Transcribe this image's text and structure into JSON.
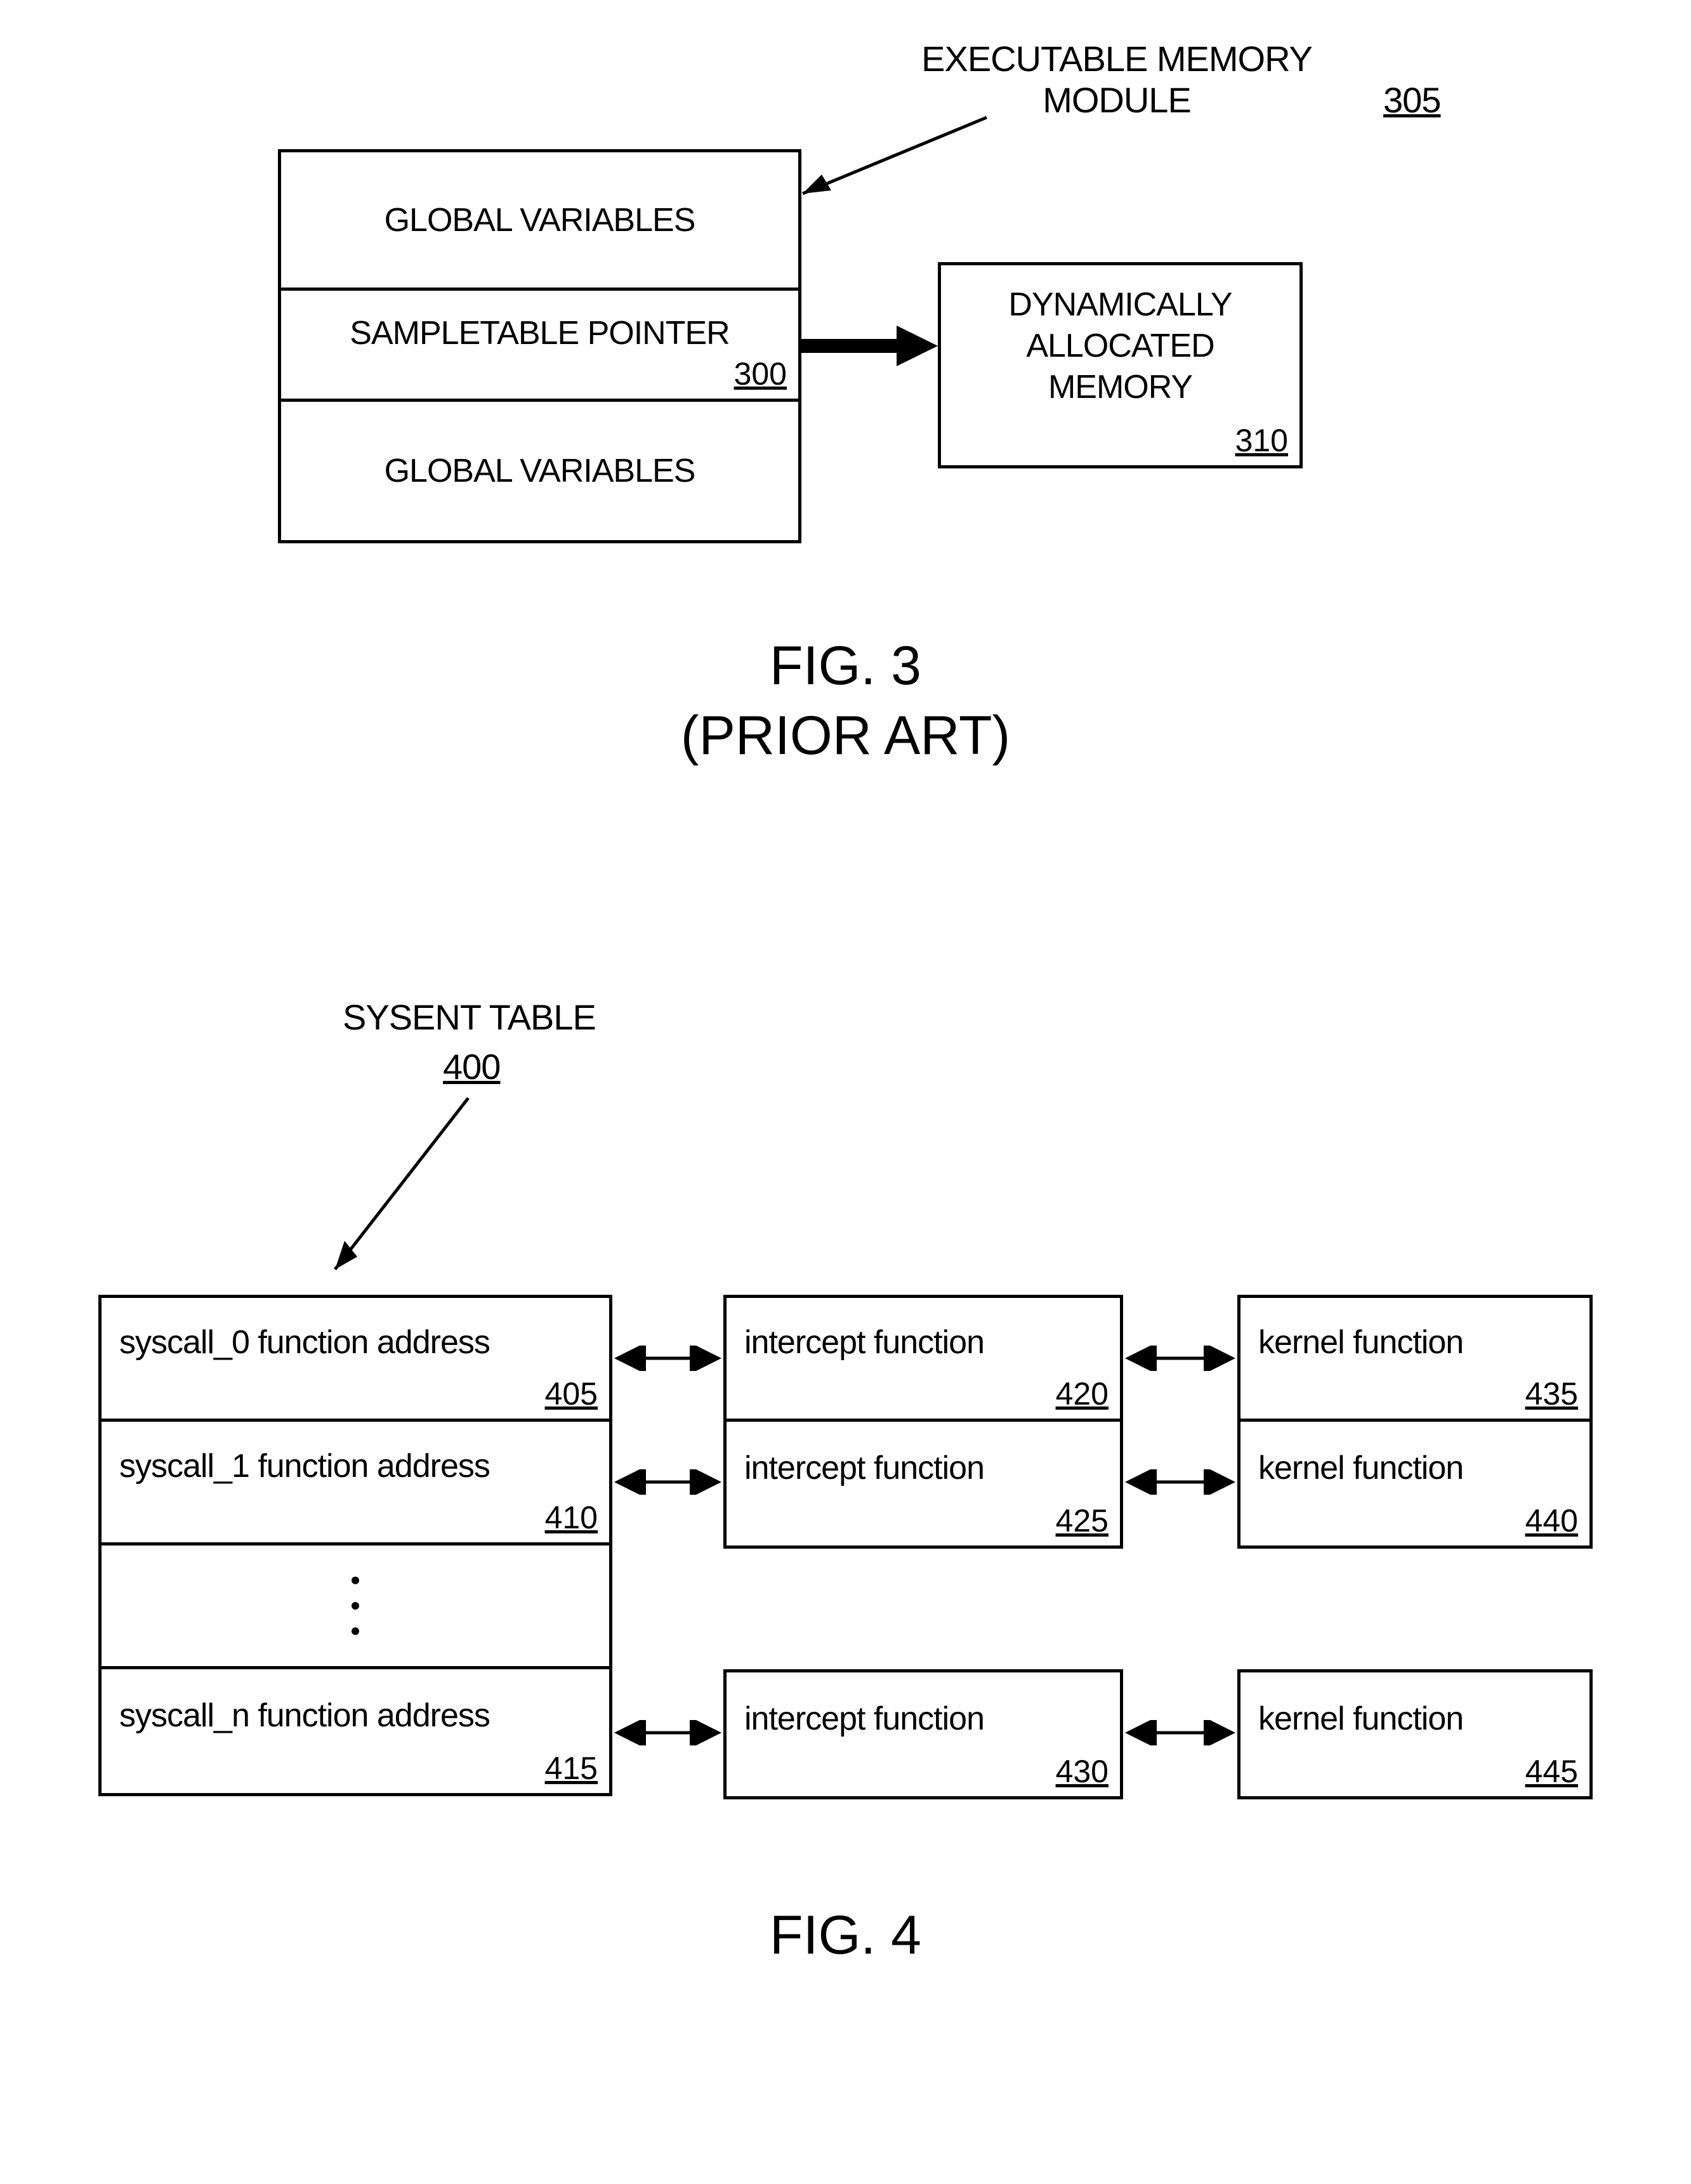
{
  "fig3": {
    "title_label": "EXECUTABLE MEMORY\nMODULE",
    "title_ref": "305",
    "module": {
      "row1": "GLOBAL VARIABLES",
      "row2": "SAMPLETABLE POINTER",
      "row2_ref": "300",
      "row3": "GLOBAL VARIABLES"
    },
    "dyn": {
      "text": "DYNAMICALLY\nALLOCATED\nMEMORY",
      "ref": "310"
    },
    "caption1": "FIG. 3",
    "caption2": "(PRIOR ART)"
  },
  "fig4": {
    "title_label": "SYSENT TABLE",
    "title_ref": "400",
    "sysent": {
      "r1": "syscall_0 function address",
      "r1_ref": "405",
      "r2": "syscall_1 function address",
      "r2_ref": "410",
      "rn": "syscall_n function address",
      "rn_ref": "415"
    },
    "intercept": {
      "r1": "intercept function",
      "r1_ref": "420",
      "r2": "intercept function",
      "r2_ref": "425",
      "rn": "intercept function",
      "rn_ref": "430"
    },
    "kernel": {
      "r1": "kernel function",
      "r1_ref": "435",
      "r2": "kernel function",
      "r2_ref": "440",
      "rn": "kernel function",
      "rn_ref": "445"
    },
    "caption": "FIG. 4"
  }
}
